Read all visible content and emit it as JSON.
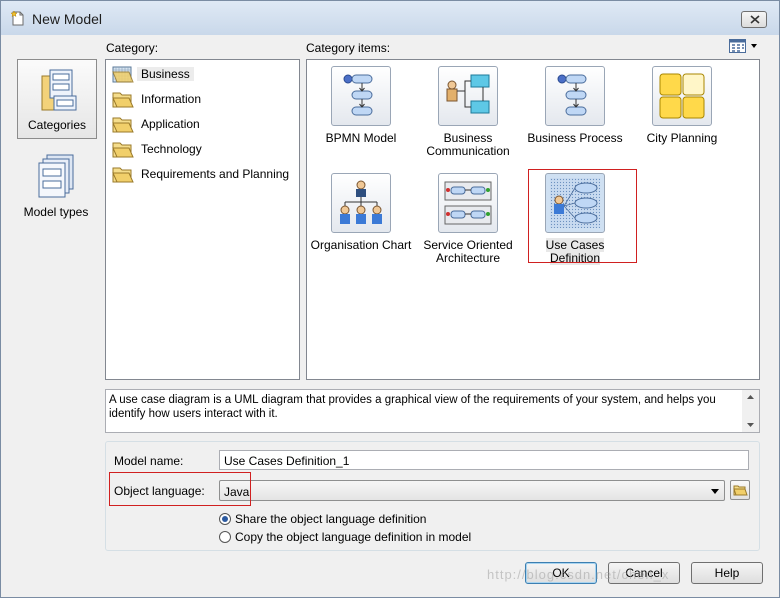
{
  "window": {
    "title": "New Model"
  },
  "labels": {
    "category": "Category:",
    "category_items": "Category items:",
    "model_name": "Model name:",
    "object_language": "Object language:"
  },
  "model_types": [
    {
      "label": "Categories",
      "icon": "categories-icon",
      "selected": true
    },
    {
      "label": "Model types",
      "icon": "model-types-icon",
      "selected": false
    }
  ],
  "categories": [
    {
      "label": "Business",
      "selected": true
    },
    {
      "label": "Information",
      "selected": false
    },
    {
      "label": "Application",
      "selected": false
    },
    {
      "label": "Technology",
      "selected": false
    },
    {
      "label": "Requirements and Planning",
      "selected": false
    }
  ],
  "category_items": [
    {
      "line1": "BPMN Model",
      "line2": "",
      "icon": "bpmn-icon"
    },
    {
      "line1": "Business",
      "line2": "Communication",
      "icon": "business-communication-icon"
    },
    {
      "line1": "Business Process",
      "line2": "",
      "icon": "business-process-icon"
    },
    {
      "line1": "City Planning",
      "line2": "",
      "icon": "city-planning-icon"
    },
    {
      "line1": "Organisation Chart",
      "line2": "",
      "icon": "organisation-chart-icon"
    },
    {
      "line1": "Service Oriented",
      "line2": "Architecture",
      "icon": "soa-icon"
    },
    {
      "line1": "Use Cases Definition",
      "line2": "",
      "icon": "use-cases-icon",
      "selected": true
    }
  ],
  "description": "A use case diagram is a UML diagram that provides a graphical view of the requirements of your system, and helps you identify how users interact with it.",
  "form": {
    "model_name_value": "Use Cases Definition_1",
    "object_language_value": "Java",
    "radio_share": "Share the object language definition",
    "radio_copy": "Copy the object language definition in model",
    "selected_radio": "share"
  },
  "buttons": {
    "ok": "OK",
    "cancel": "Cancel",
    "help": "Help"
  },
  "watermark": "http://blog.csdn.net/chen_x"
}
